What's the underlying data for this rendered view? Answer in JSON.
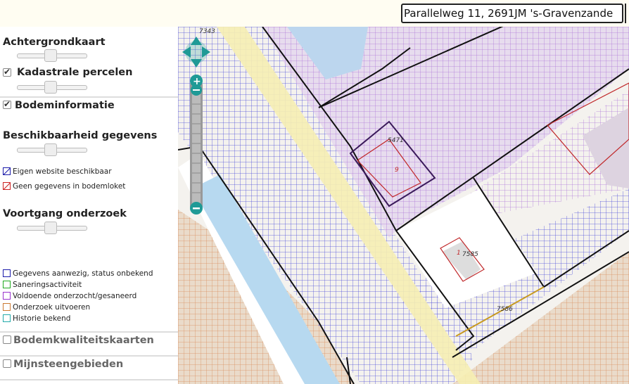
{
  "search": {
    "value": "Parallelweg 11, 2691JM 's-Gravenzande"
  },
  "sidebar": {
    "achtergrondkaart": "Achtergrondkaart",
    "kadastrale": "Kadastrale percelen",
    "bodeminformatie": "Bodeminformatie",
    "beschikbaarheid": "Beschikbaarheid gegevens",
    "beschikbaarheid_legend": [
      {
        "label": "Eigen website beschikbaar",
        "color": "#1a1aaa"
      },
      {
        "label": "Geen gegevens in bodemloket",
        "color": "#cc2222"
      }
    ],
    "voortgang": "Voortgang onderzoek",
    "voortgang_legend": [
      {
        "label": "Gegevens aanwezig, status onbekend",
        "color": "#1a1aaa"
      },
      {
        "label": "Saneringsactiviteit",
        "color": "#22aa22"
      },
      {
        "label": "Voldoende onderzocht/gesaneerd",
        "color": "#9933cc"
      },
      {
        "label": "Onderzoek uitvoeren",
        "color": "#cc7a33"
      },
      {
        "label": "Historie bekend",
        "color": "#22aaaa"
      }
    ],
    "bodemkwaliteit": "Bodemkwaliteitskaarten",
    "mijnsteen": "Mijnsteengebieden"
  },
  "map": {
    "parcel_labels": [
      "7343",
      "5471",
      "9",
      "1",
      "7585",
      "7586"
    ]
  },
  "colors": {
    "purple_hatch": "#a35cd6",
    "blue_hatch": "#4a4ad8",
    "orange_hatch": "#d98a4a",
    "water": "#b7d9f0",
    "road_yellow": "#f7efb5",
    "control_teal": "#1f9a96"
  }
}
